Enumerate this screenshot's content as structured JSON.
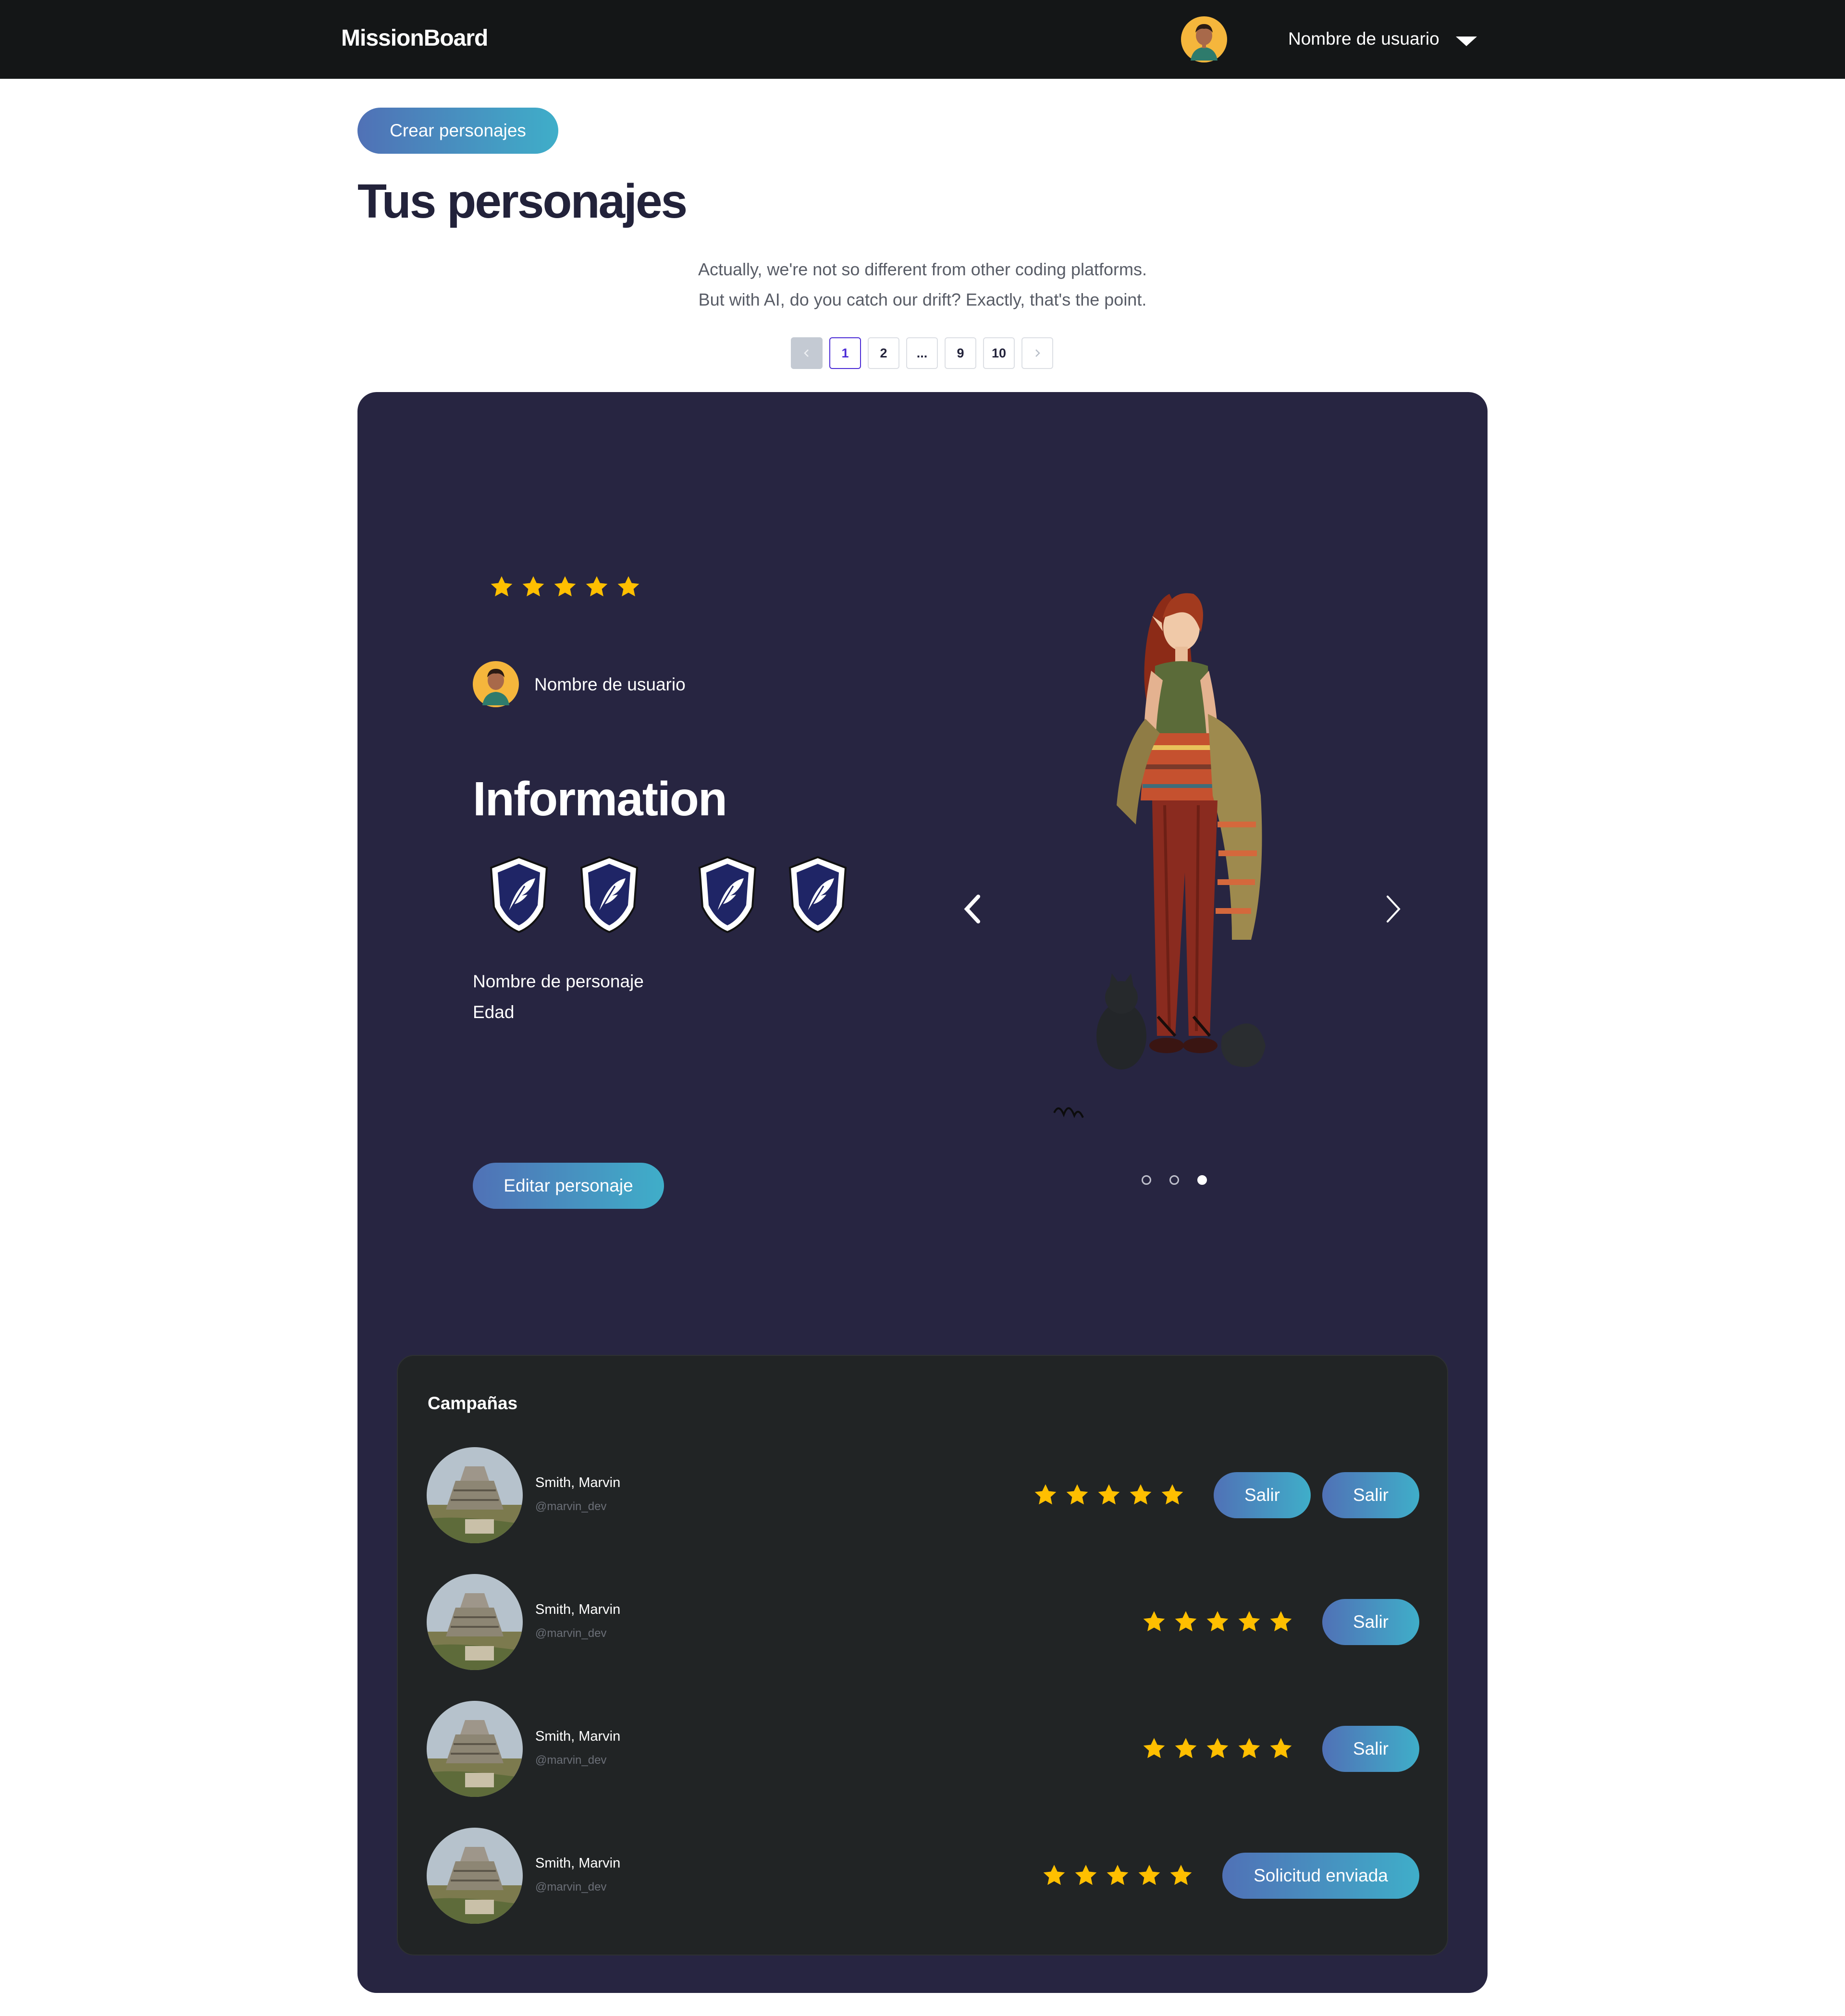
{
  "nav": {
    "brand": "MissionBoard",
    "username": "Nombre de usuario",
    "icons": [
      "avatar",
      "chevron-down-icon"
    ]
  },
  "header": {
    "create_button": "Crear  personajes",
    "title": "Tus personajes",
    "tagline_1": "Actually, we're not so different from other coding platforms.",
    "tagline_2": "But with AI, do you catch our drift? Exactly, that's the point."
  },
  "pagination": {
    "prev_icon": "chevron-left-icon",
    "pages": [
      "1",
      "2",
      "...",
      "9",
      "10"
    ],
    "current": "1",
    "next_icon": "chevron-right-icon"
  },
  "character": {
    "rating": 5,
    "owner_name": "Nombre de usuario",
    "info_title": "Information",
    "badges": [
      "quill-shield-icon",
      "quill-shield-icon",
      "quill-shield-icon",
      "quill-shield-icon"
    ],
    "name_label": "Nombre de personaje",
    "age_label": "Edad",
    "edit_button": "Editar personaje",
    "carousel_slides": 3,
    "carousel_active": 3
  },
  "campaigns": {
    "title": "Campañas",
    "rows": [
      {
        "name": "Smith, Marvin",
        "handle": "@marvin_dev",
        "rating": 5,
        "buttons": [
          "Salir",
          "Salir"
        ]
      },
      {
        "name": "Smith, Marvin",
        "handle": "@marvin_dev",
        "rating": 5,
        "buttons": [
          "Salir"
        ]
      },
      {
        "name": "Smith, Marvin",
        "handle": "@marvin_dev",
        "rating": 5,
        "buttons": [
          "Salir"
        ]
      },
      {
        "name": "Smith, Marvin",
        "handle": "@marvin_dev",
        "rating": 5,
        "buttons": [
          "Solicitud enviada"
        ]
      }
    ]
  },
  "colors": {
    "nav_bg": "#141617",
    "card_bg": "#272541",
    "panel_bg": "#212425",
    "star": "#ffbf00",
    "button_gradient": [
      "#5071b6",
      "#3faec9"
    ],
    "active_page": "#4b2bd6"
  }
}
